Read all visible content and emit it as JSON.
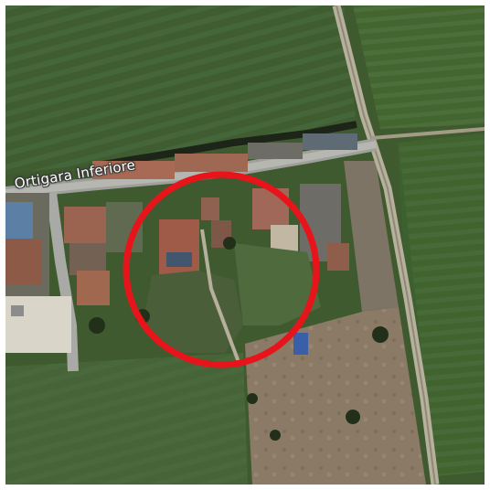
{
  "map": {
    "road_label": "Ortigara Inferiore",
    "marker": {
      "shape": "circle",
      "color": "#e8141b"
    },
    "view": "satellite"
  }
}
